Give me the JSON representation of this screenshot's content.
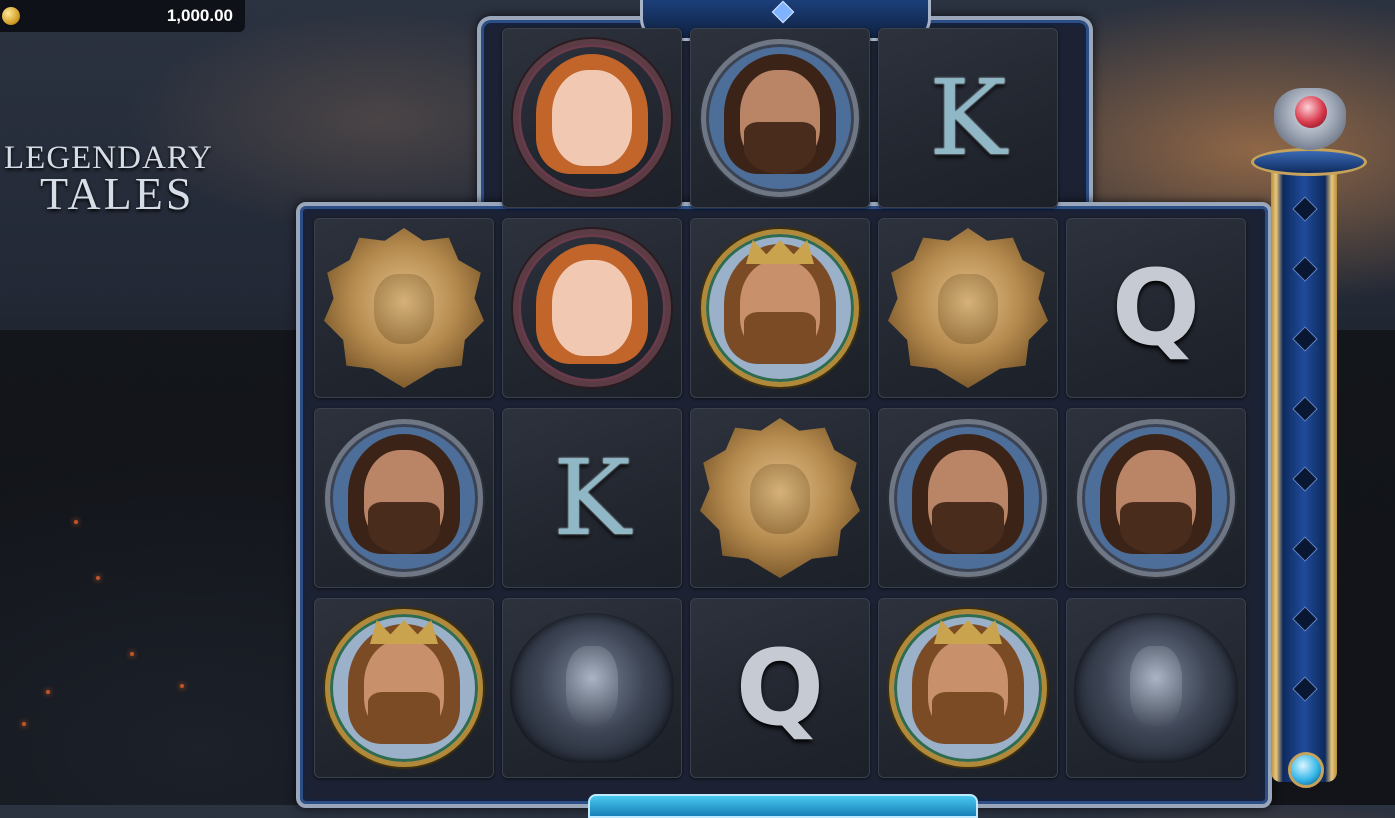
{
  "balance": {
    "value": "1,000.00",
    "coin_icon": "gold-coin-icon"
  },
  "logo": {
    "line1": "LEGENDARY",
    "line2": "TALES"
  },
  "reels": {
    "top_row": [
      "queen",
      "warrior",
      "k"
    ],
    "rows": [
      [
        "lion",
        "queen",
        "king",
        "lion",
        "q"
      ],
      [
        "warrior",
        "k",
        "lion",
        "warrior",
        "warrior"
      ],
      [
        "king",
        "dragon",
        "q",
        "king",
        "dragon"
      ]
    ]
  },
  "meter": {
    "top_icon": "ruby-ring-icon",
    "bottom_icon": "blue-orb-icon"
  },
  "letters": {
    "k": "K",
    "q": "Q"
  },
  "colors": {
    "frame_blue": "#2b4e86",
    "frame_silver": "#9aa7bb",
    "meter_gold": "#c6a25a",
    "panel_cyan": "#49c9f0"
  }
}
